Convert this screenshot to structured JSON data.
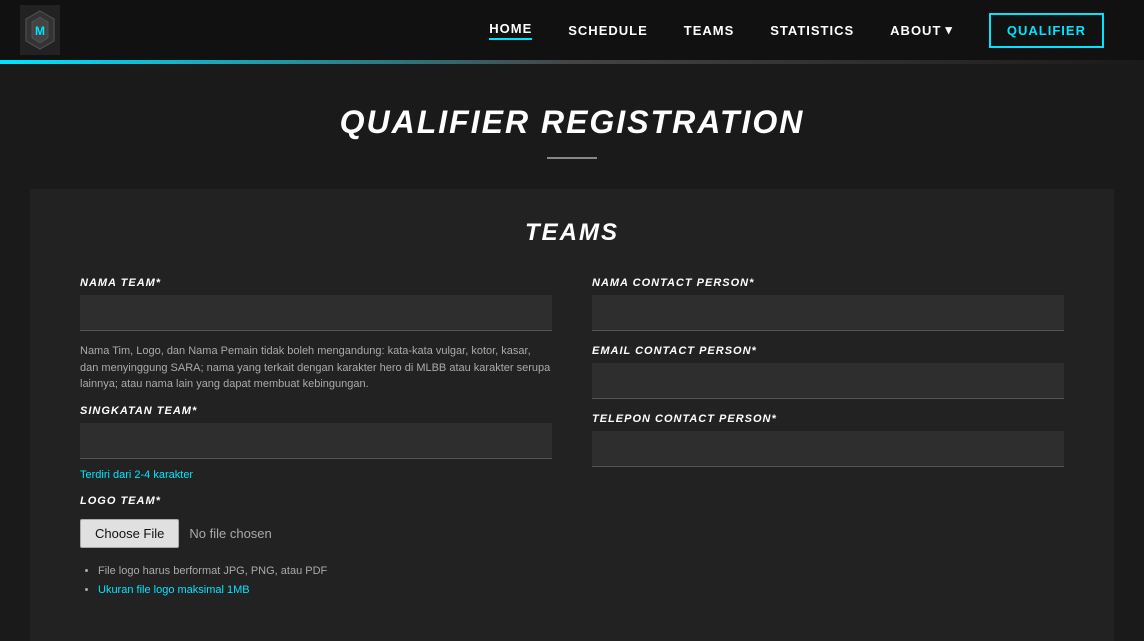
{
  "nav": {
    "links": [
      {
        "id": "home",
        "label": "HOME",
        "active": true
      },
      {
        "id": "schedule",
        "label": "SCHEDULE",
        "active": false
      },
      {
        "id": "teams",
        "label": "TEAMS",
        "active": false
      },
      {
        "id": "statistics",
        "label": "STATISTICS",
        "active": false
      },
      {
        "id": "about",
        "label": "ABOUT",
        "active": false
      }
    ],
    "qualifier_button": "QUALIFIER"
  },
  "page": {
    "title": "QUALIFIER REGISTRATION"
  },
  "form": {
    "section_title": "TEAMS",
    "fields": {
      "nama_team_label": "NAMA TEAM*",
      "nama_note": "Nama Tim, Logo, dan Nama Pemain tidak boleh mengandung: kata-kata vulgar, kotor, kasar, dan menyinggung SARA; nama yang terkait dengan karakter hero di MLBB atau karakter serupa lainnya; atau nama lain yang dapat membuat kebingungan.",
      "singkatan_team_label": "SINGKATAN TEAM*",
      "singkatan_note": "Terdiri dari 2-4 karakter",
      "logo_team_label": "LOGO TEAM*",
      "choose_file_btn": "Choose File",
      "no_file_chosen": "No file chosen",
      "file_req_1": "File logo harus berformat JPG, PNG, atau PDF",
      "file_req_2": "Ukuran file logo maksimal 1MB",
      "nama_contact_label": "NAMA CONTACT PERSON*",
      "email_contact_label": "EMAIL CONTACT PERSON*",
      "telepon_contact_label": "TELEPON CONTACT PERSON*"
    }
  }
}
